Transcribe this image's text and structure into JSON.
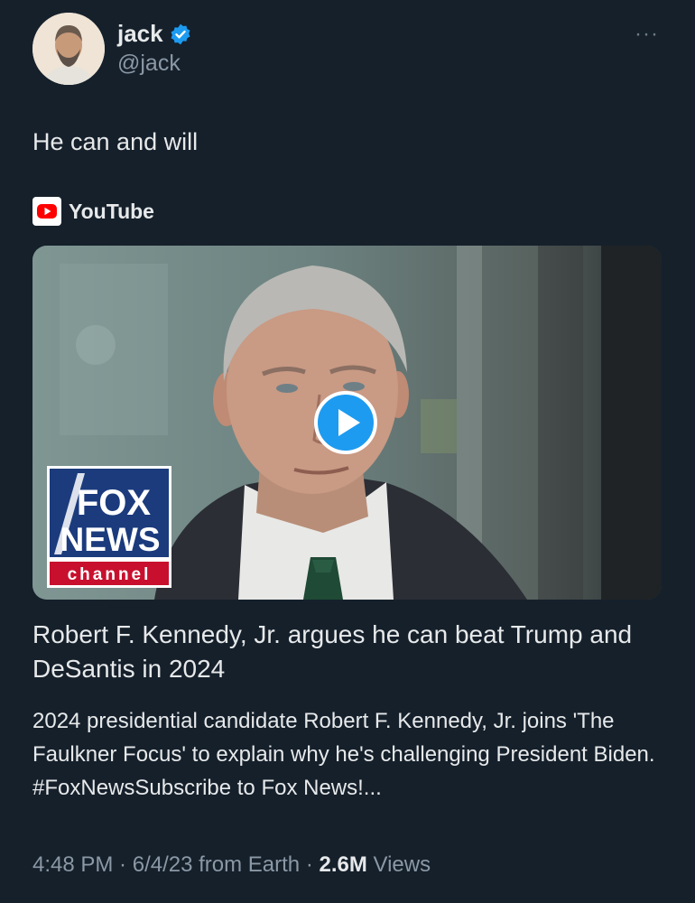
{
  "author": {
    "name": "jack",
    "handle": "@jack",
    "verified_badge_color": "#1d9bf0"
  },
  "tweet": {
    "text": "He can and will"
  },
  "more_menu": {
    "icon": "more-horizontal-icon",
    "glyph": "···"
  },
  "link_card": {
    "source": "YouTube",
    "source_icon": "youtube-icon",
    "thumbnail": {
      "play_icon": "play-icon",
      "logo": {
        "line1": "FOX",
        "line2": "NEWS",
        "line3": "channel"
      }
    },
    "title": "Robert F. Kennedy, Jr. argues he can beat Trump and DeSantis in 2024",
    "description": "2024 presidential candidate Robert F. Kennedy, Jr. joins 'The Faulkner Focus' to explain why he's challenging President Biden. #FoxNewsSubscribe to Fox News!..."
  },
  "meta": {
    "time": "4:48 PM",
    "sep1": " · ",
    "date": "6/4/23",
    "source_text": " from Earth",
    "sep2": " · ",
    "views_count": "2.6M",
    "views_label": " Views"
  },
  "colors": {
    "background": "#15202b",
    "text_primary": "#e7e9ea",
    "text_secondary": "#8b98a5",
    "accent": "#1d9bf0",
    "youtube_red": "#ff0000"
  }
}
